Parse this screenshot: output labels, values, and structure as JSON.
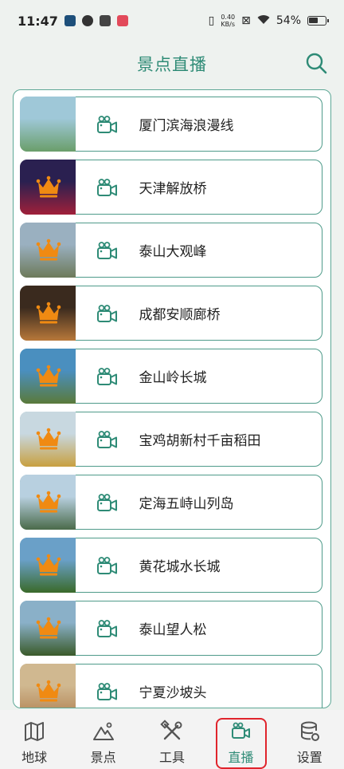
{
  "status": {
    "time": "11:47",
    "net_speed_value": "0.40",
    "net_speed_unit": "KB/s",
    "battery": "54%"
  },
  "header": {
    "title": "景点直播"
  },
  "list": {
    "items": [
      {
        "label": "厦门滨海浪漫线",
        "vip": false,
        "colors": [
          "#9fc8d8",
          "#6a9e6a"
        ]
      },
      {
        "label": "天津解放桥",
        "vip": true,
        "colors": [
          "#2a2050",
          "#a0203a"
        ]
      },
      {
        "label": "泰山大观峰",
        "vip": true,
        "colors": [
          "#9ab0c0",
          "#6d7a5a"
        ]
      },
      {
        "label": "成都安顺廊桥",
        "vip": true,
        "colors": [
          "#3a2a1e",
          "#b8783a"
        ]
      },
      {
        "label": "金山岭长城",
        "vip": true,
        "colors": [
          "#4a8fbf",
          "#5a7a3a"
        ]
      },
      {
        "label": "宝鸡胡新村千亩稻田",
        "vip": true,
        "colors": [
          "#c8d8e0",
          "#c8a040"
        ]
      },
      {
        "label": "定海五峙山列岛",
        "vip": true,
        "colors": [
          "#b8d0e0",
          "#4a6a4a"
        ]
      },
      {
        "label": "黄花城水长城",
        "vip": true,
        "colors": [
          "#6aa0c8",
          "#3a6a2a"
        ]
      },
      {
        "label": "泰山望人松",
        "vip": true,
        "colors": [
          "#8ab0c8",
          "#3a5a2a"
        ]
      },
      {
        "label": "宁夏沙坡头",
        "vip": true,
        "colors": [
          "#d0b890",
          "#b08050"
        ]
      }
    ]
  },
  "tabs": [
    {
      "label": "地球",
      "icon": "map-icon"
    },
    {
      "label": "景点",
      "icon": "mountain-icon"
    },
    {
      "label": "工具",
      "icon": "tools-icon"
    },
    {
      "label": "直播",
      "icon": "camera-icon",
      "active": true
    },
    {
      "label": "设置",
      "icon": "database-settings-icon"
    }
  ],
  "colors": {
    "accent": "#2e8b76",
    "crown": "#f08a12",
    "highlight": "#e0242c"
  }
}
